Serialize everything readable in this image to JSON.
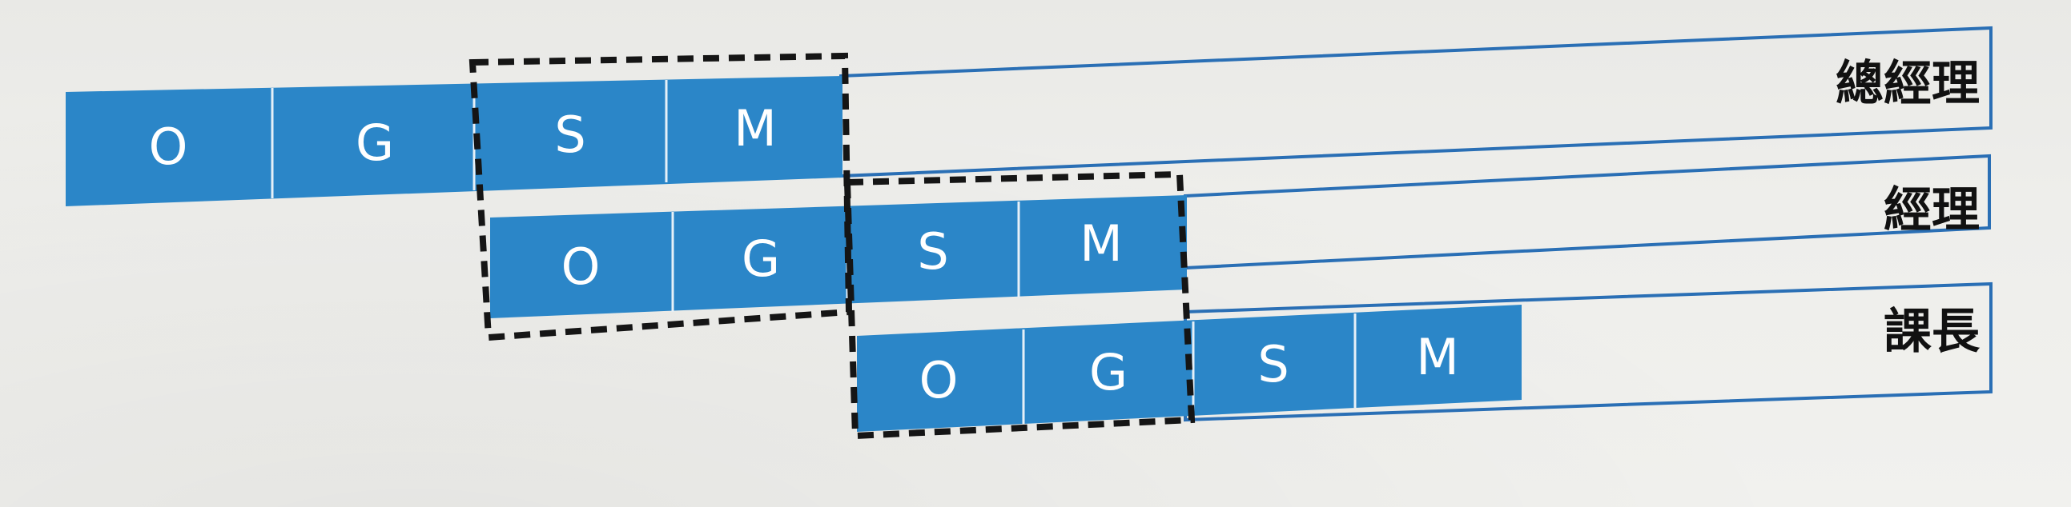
{
  "levels": [
    {
      "label": "總經理",
      "cells": [
        "O",
        "G",
        "S",
        "M"
      ]
    },
    {
      "label": "經理",
      "cells": [
        "O",
        "G",
        "S",
        "M"
      ]
    },
    {
      "label": "課長",
      "cells": [
        "O",
        "G",
        "S",
        "M"
      ]
    }
  ],
  "colors": {
    "bar_blue": "#2b86c8",
    "frame_line": "#2a6fb5",
    "divider": "#e6f0f8",
    "dashed_box": "#151515",
    "label_text": "#111111"
  }
}
